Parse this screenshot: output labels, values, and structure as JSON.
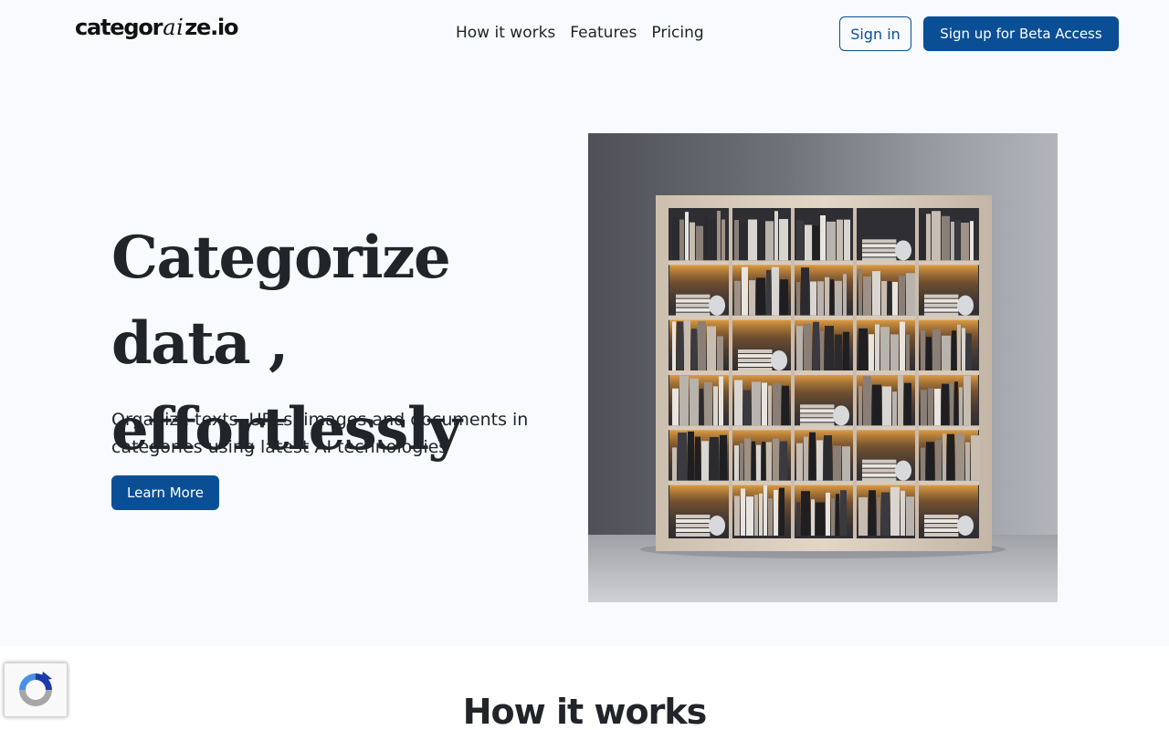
{
  "brand": {
    "logo_prefix": "categor",
    "logo_ai": "ai",
    "logo_suffix": "ze.io"
  },
  "nav": {
    "links": [
      {
        "label": "How it works"
      },
      {
        "label": "Features"
      },
      {
        "label": "Pricing"
      }
    ],
    "sign_in": "Sign in",
    "sign_up": "Sign up for Beta Access"
  },
  "hero": {
    "title_line1": "Categorize data ,",
    "title_line2": "effortlessly",
    "subtitle": "Organize texts, URLs, images and documents in categories using latest AI technologies",
    "cta": "Learn More"
  },
  "how_it_works": {
    "title": "How it works"
  },
  "icons": {
    "recaptcha": "recaptcha-icon",
    "hero_image": "bookshelf-illustration"
  },
  "colors": {
    "primary": "#0a4f96",
    "hero_background": "#f8fafd",
    "text": "#212529"
  }
}
